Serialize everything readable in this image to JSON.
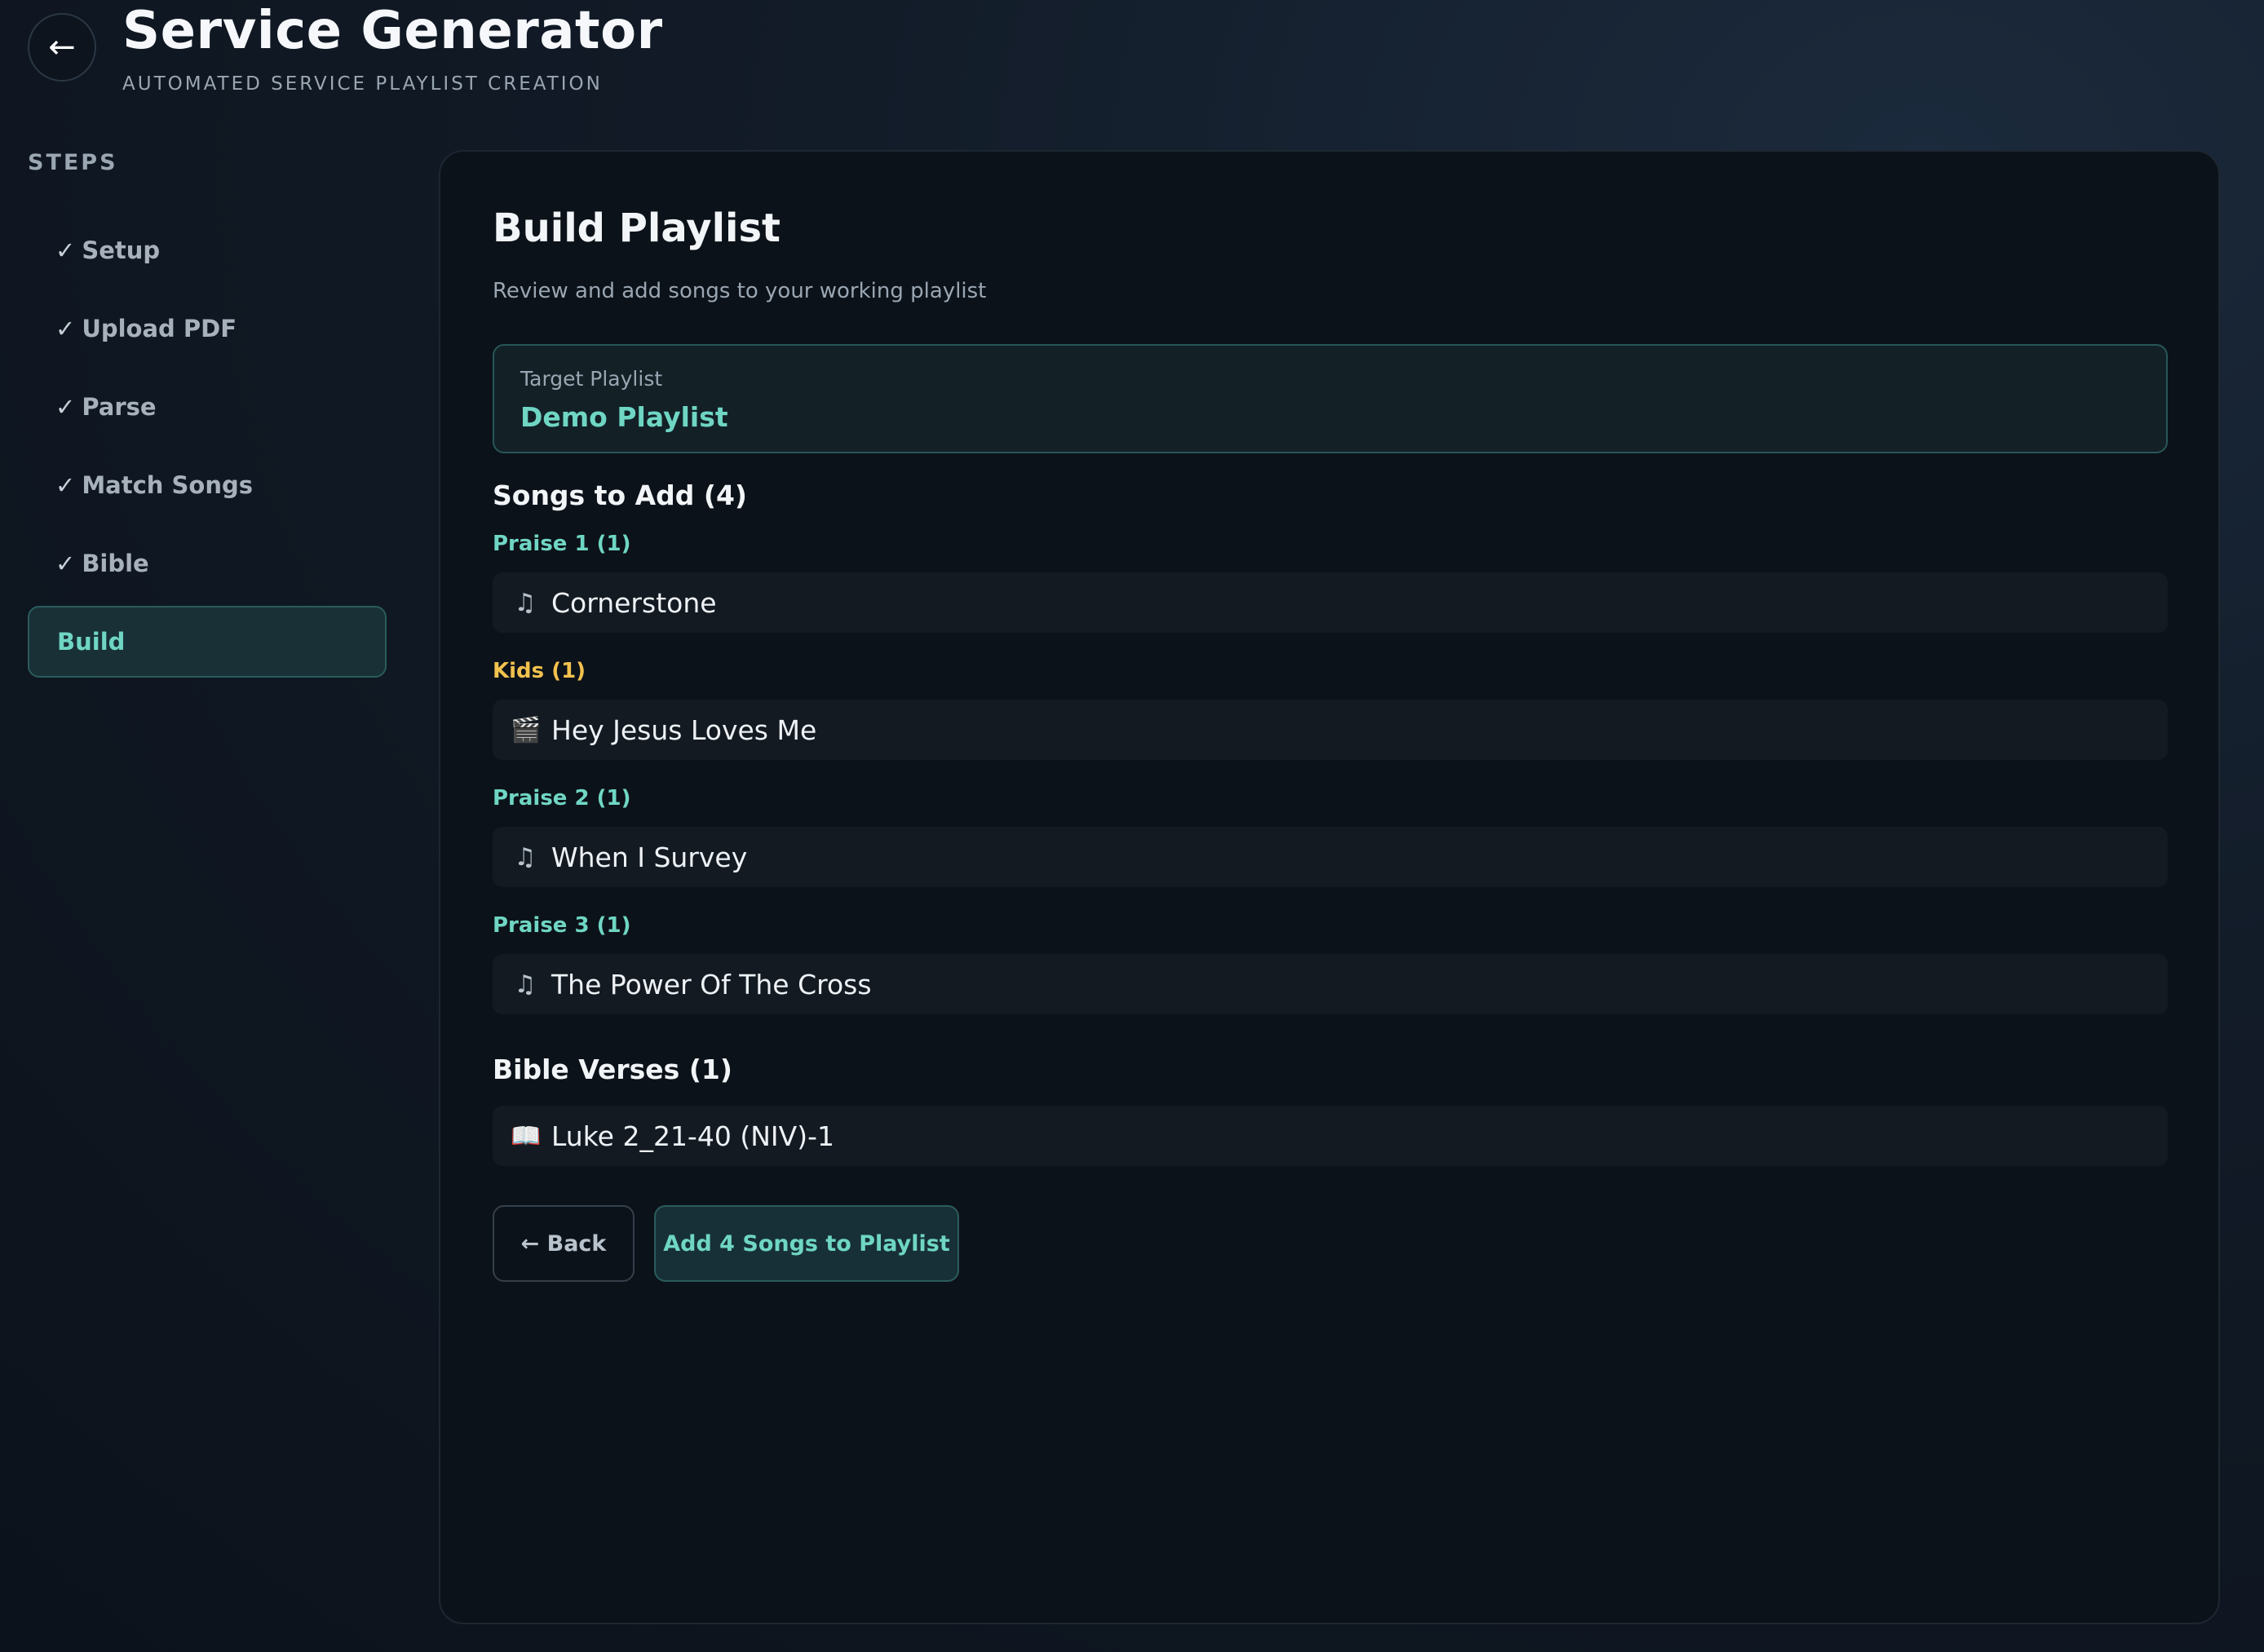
{
  "header": {
    "back_icon": "←",
    "title": "Service Generator",
    "subtitle": "AUTOMATED SERVICE PLAYLIST CREATION"
  },
  "sidebar": {
    "label": "STEPS",
    "check_glyph": "✓",
    "items": [
      {
        "label": "Setup",
        "done": true
      },
      {
        "label": "Upload PDF",
        "done": true
      },
      {
        "label": "Parse",
        "done": true
      },
      {
        "label": "Match Songs",
        "done": true
      },
      {
        "label": "Bible",
        "done": true
      },
      {
        "label": "Build",
        "done": false,
        "active": true
      }
    ]
  },
  "main": {
    "title": "Build Playlist",
    "subtitle": "Review and add songs to your working playlist",
    "target": {
      "label": "Target Playlist",
      "value": "Demo Playlist"
    },
    "songs_heading": "Songs to Add (4)",
    "groups": [
      {
        "label": "Praise 1 (1)",
        "color": "#6fd6c4",
        "items": [
          {
            "icon": "music-note-icon",
            "glyph": "♫",
            "title": "Cornerstone"
          }
        ]
      },
      {
        "label": "Kids (1)",
        "color": "#f2c14e",
        "items": [
          {
            "icon": "clapperboard-icon",
            "glyph": "🎬",
            "title": "Hey Jesus Loves Me"
          }
        ]
      },
      {
        "label": "Praise 2 (1)",
        "color": "#6fd6c4",
        "items": [
          {
            "icon": "music-note-icon",
            "glyph": "♫",
            "title": "When I Survey"
          }
        ]
      },
      {
        "label": "Praise 3 (1)",
        "color": "#6fd6c4",
        "items": [
          {
            "icon": "music-note-icon",
            "glyph": "♫",
            "title": "The Power Of The Cross"
          }
        ]
      }
    ],
    "bible_heading": "Bible Verses (1)",
    "bible_items": [
      {
        "icon": "book-icon",
        "glyph": "📖",
        "title": "Luke 2_21-40 (NIV)-1"
      }
    ],
    "back_button": "← Back",
    "add_button": "Add 4 Songs to Playlist"
  },
  "colors": {
    "accent": "#6fd6c4",
    "kids": "#f2c14e"
  }
}
